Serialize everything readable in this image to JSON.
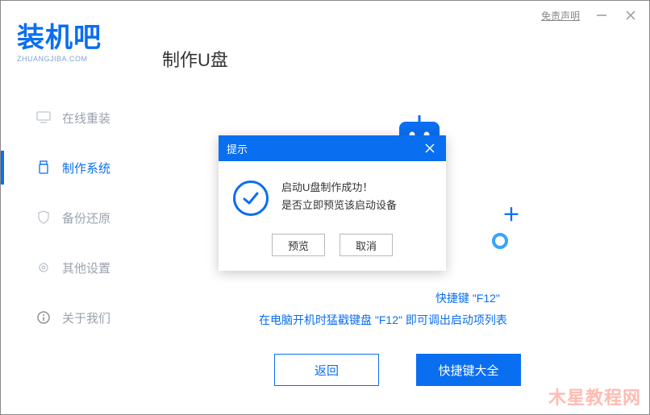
{
  "titlebar": {
    "disclaimer": "免责声明"
  },
  "logo": {
    "main": "装机吧",
    "sub": "ZHUANGJIBA.COM"
  },
  "page_title": "制作U盘",
  "sidebar": {
    "items": [
      {
        "label": "在线重装"
      },
      {
        "label": "制作系统"
      },
      {
        "label": "备份还原"
      },
      {
        "label": "其他设置"
      },
      {
        "label": "关于我们"
      }
    ]
  },
  "hint": {
    "line1_tail": "快捷键 \"F12\"",
    "line2": "在电脑开机时猛戳键盘 \"F12\" 即可调出启动项列表"
  },
  "bottom": {
    "back": "返回",
    "hotkeys": "快捷键大全"
  },
  "modal": {
    "title": "提示",
    "body_line1": "启动U盘制作成功！",
    "body_line2": "是否立即预览该启动设备",
    "preview": "预览",
    "cancel": "取消"
  },
  "watermark": "木星教程网"
}
